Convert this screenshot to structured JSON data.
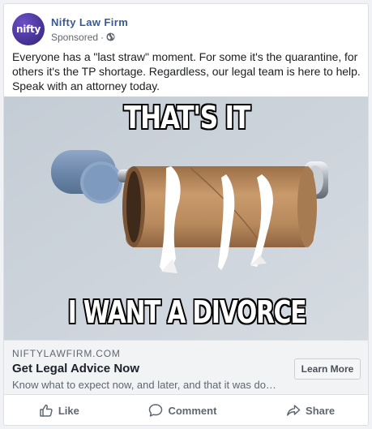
{
  "post": {
    "avatar_text": "nifty",
    "page_name": "Nifty Law Firm",
    "sponsored_label": "Sponsored",
    "separator": "·",
    "privacy_icon": "globe-icon",
    "text": "Everyone has a \"last straw\" moment. For some it's the quarantine, for others it's the TP shortage. Regardless, our legal team is here to help. Speak with an attorney today."
  },
  "meme": {
    "top_text": "THAT'S IT",
    "bottom_text": "I WANT A DIVORCE"
  },
  "link_preview": {
    "domain": "NIFTYLAWFIRM.COM",
    "title": "Get Legal Advice Now",
    "description": "Know what to expect now, and later, and that it was done…",
    "cta_label": "Learn More"
  },
  "actions": [
    {
      "label": "Like",
      "icon": "thumbs-up-icon"
    },
    {
      "label": "Comment",
      "icon": "comment-icon"
    },
    {
      "label": "Share",
      "icon": "share-icon"
    }
  ],
  "colors": {
    "page_name": "#385898",
    "avatar": "#43318f",
    "secondary_text": "#606770"
  }
}
